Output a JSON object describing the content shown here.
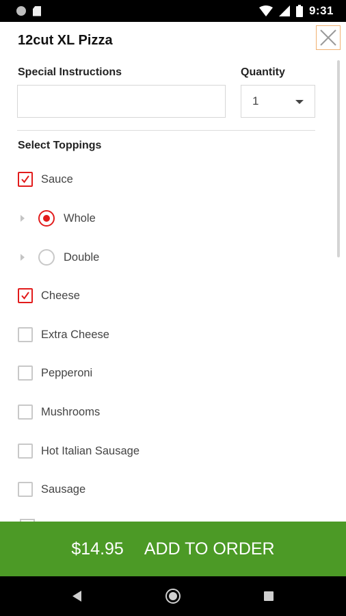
{
  "status_bar": {
    "time": "9:31"
  },
  "dialog": {
    "title": "12cut XL Pizza",
    "special_instructions_label": "Special Instructions",
    "special_instructions_value": "",
    "quantity_label": "Quantity",
    "quantity_value": "1",
    "toppings_label": "Select Toppings"
  },
  "toppings": [
    {
      "label": "Sauce",
      "checked": true
    },
    {
      "label": "Cheese",
      "checked": true
    },
    {
      "label": "Extra Cheese",
      "checked": false
    },
    {
      "label": "Pepperoni",
      "checked": false
    },
    {
      "label": "Mushrooms",
      "checked": false
    },
    {
      "label": "Hot Italian Sausage",
      "checked": false
    },
    {
      "label": "Sausage",
      "checked": false
    }
  ],
  "sauce_options": [
    {
      "label": "Whole",
      "selected": true
    },
    {
      "label": "Double",
      "selected": false
    }
  ],
  "order": {
    "price": "$14.95",
    "label": "ADD TO ORDER"
  },
  "colors": {
    "accent_red": "#e21b1b",
    "order_green": "#4c9a26",
    "close_border": "#f0b070"
  }
}
